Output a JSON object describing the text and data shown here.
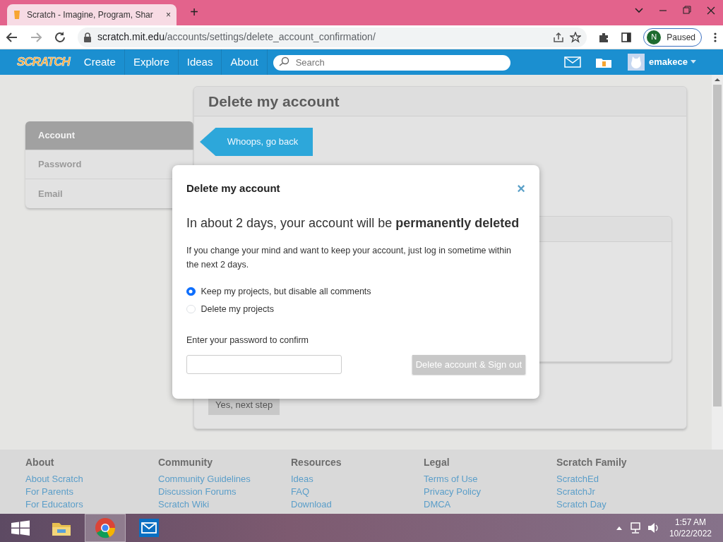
{
  "browser": {
    "tab_title": "Scratch - Imagine, Program, Shar",
    "tab_close": "×",
    "new_tab": "+",
    "url_domain": "scratch.mit.edu",
    "url_path": "/accounts/settings/delete_account_confirmation/",
    "profile": {
      "initial": "N",
      "status": "Paused"
    }
  },
  "scratch_nav": {
    "logo": "SCRATCH",
    "links": [
      "Create",
      "Explore",
      "Ideas",
      "About"
    ],
    "search": {
      "placeholder": "Search"
    },
    "username": "emakece"
  },
  "settings_sidebar": {
    "items": [
      {
        "label": "Account",
        "selected": true
      },
      {
        "label": "Password",
        "selected": false
      },
      {
        "label": "Email",
        "selected": false
      }
    ]
  },
  "account_panel": {
    "title": "Delete my account",
    "back_button": "Whoops, go back",
    "next_button": "Yes, next step"
  },
  "modal": {
    "title": "Delete my account",
    "close": "×",
    "heading": "In about 2 days, your account will be **permanently deleted**",
    "body": "If you change your mind and want to keep your account, just log in sometime within the next 2 days.",
    "options": [
      {
        "label": "Keep my projects, but disable all comments",
        "selected": true
      },
      {
        "label": "Delete my projects",
        "selected": false
      }
    ],
    "password_label": "Enter your password to confirm",
    "submit": {
      "label": "Delete account & Sign out",
      "disabled": true
    }
  },
  "footer": {
    "columns": [
      {
        "heading": "About",
        "links": [
          "About Scratch",
          "For Parents",
          "For Educators"
        ]
      },
      {
        "heading": "Community",
        "links": [
          "Community Guidelines",
          "Discussion Forums",
          "Scratch Wiki"
        ]
      },
      {
        "heading": "Resources",
        "links": [
          "Ideas",
          "FAQ",
          "Download"
        ]
      },
      {
        "heading": "Legal",
        "links": [
          "Terms of Use",
          "Privacy Policy",
          "DMCA"
        ]
      },
      {
        "heading": "Scratch Family",
        "links": [
          "ScratchEd",
          "ScratchJr",
          "Scratch Day"
        ]
      }
    ]
  },
  "taskbar": {
    "apps": [
      {
        "kind": "explorer",
        "selected": false
      },
      {
        "kind": "chrome",
        "selected": true
      },
      {
        "kind": "mail",
        "selected": false
      }
    ],
    "time": "1:57 AM",
    "date": "10/22/2022"
  }
}
